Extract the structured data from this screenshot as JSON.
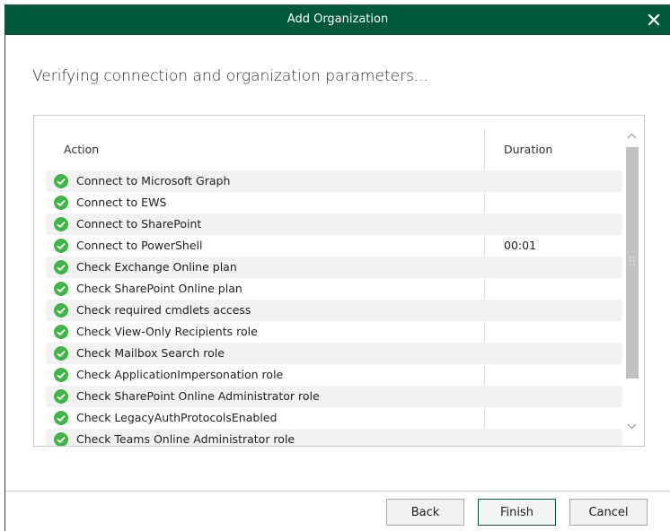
{
  "window": {
    "title": "Add Organization",
    "close_icon": "close-icon"
  },
  "heading": "Verifying connection and organization parameters...",
  "table": {
    "columns": {
      "action": "Action",
      "duration": "Duration"
    },
    "rows": [
      {
        "action": "Connect to Microsoft Graph",
        "duration": "",
        "status": "success"
      },
      {
        "action": "Connect to EWS",
        "duration": "",
        "status": "success"
      },
      {
        "action": "Connect to SharePoint",
        "duration": "",
        "status": "success"
      },
      {
        "action": "Connect to PowerShell",
        "duration": "00:01",
        "status": "success"
      },
      {
        "action": "Check Exchange Online plan",
        "duration": "",
        "status": "success"
      },
      {
        "action": "Check SharePoint Online plan",
        "duration": "",
        "status": "success"
      },
      {
        "action": "Check required cmdlets access",
        "duration": "",
        "status": "success"
      },
      {
        "action": "Check View-Only Recipients role",
        "duration": "",
        "status": "success"
      },
      {
        "action": "Check Mailbox Search role",
        "duration": "",
        "status": "success"
      },
      {
        "action": "Check ApplicationImpersonation role",
        "duration": "",
        "status": "success"
      },
      {
        "action": "Check SharePoint Online Administrator role",
        "duration": "",
        "status": "success"
      },
      {
        "action": "Check LegacyAuthProtocolsEnabled",
        "duration": "",
        "status": "success"
      },
      {
        "action": "Check Teams Online Administrator role",
        "duration": "",
        "status": "success"
      }
    ]
  },
  "buttons": {
    "back": "Back",
    "finish": "Finish",
    "cancel": "Cancel"
  },
  "colors": {
    "titlebar": "#00593b",
    "success": "#3fb54a",
    "row_alt": "#f2f2f2"
  }
}
